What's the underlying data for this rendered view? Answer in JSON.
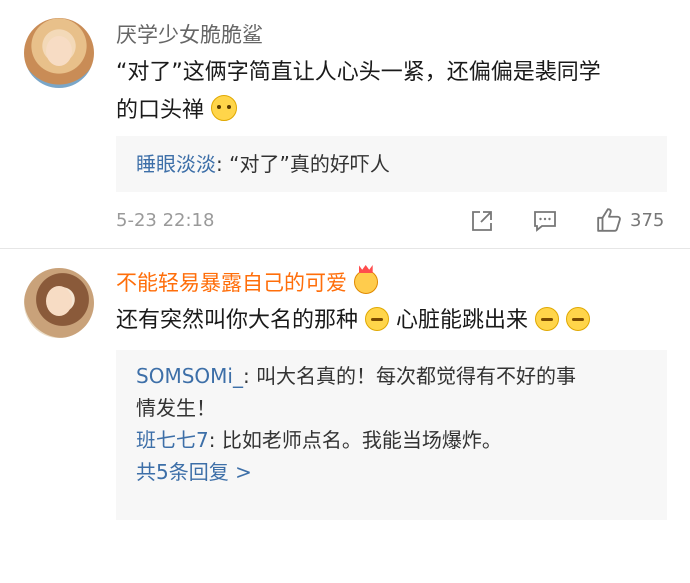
{
  "comments": [
    {
      "username": "厌学少女脆脆鲨",
      "text_line1": "“对了”这俩字简直让人心头一紧，还偏偏是裴同学",
      "text_line2": "的口头禅",
      "text_emoji": "thinking-face",
      "replies": [
        {
          "name": "睡眼淡淡",
          "sep": ": ",
          "text": "“对了”真的好吓人"
        }
      ],
      "timestamp": "5-23 22:18",
      "like_count": "375"
    },
    {
      "username": "不能轻易暴露自己的可爱",
      "username_emoji": "crown-face",
      "text_part1": "还有突然叫你大名的那种",
      "text_part2": "心脏能跳出来",
      "text_emoji": "sweat-face",
      "replies": [
        {
          "name": "SOMSOMi_",
          "sep": ": ",
          "text_line1": "叫大名真的！每次都觉得有不好的事",
          "text_line2": "情发生！"
        },
        {
          "name": "班七七7",
          "sep": ": ",
          "text": "比如老师点名。我能当场爆炸。"
        }
      ],
      "more_replies_label": "共5条回复 >"
    }
  ],
  "colors": {
    "username_vip": "#ff6e0a",
    "reply_name": "#3d6fa8",
    "reply_bg": "#f7f7f7",
    "meta": "#9a9a9a"
  },
  "icons": [
    "share-icon",
    "comment-icon",
    "like-icon"
  ]
}
